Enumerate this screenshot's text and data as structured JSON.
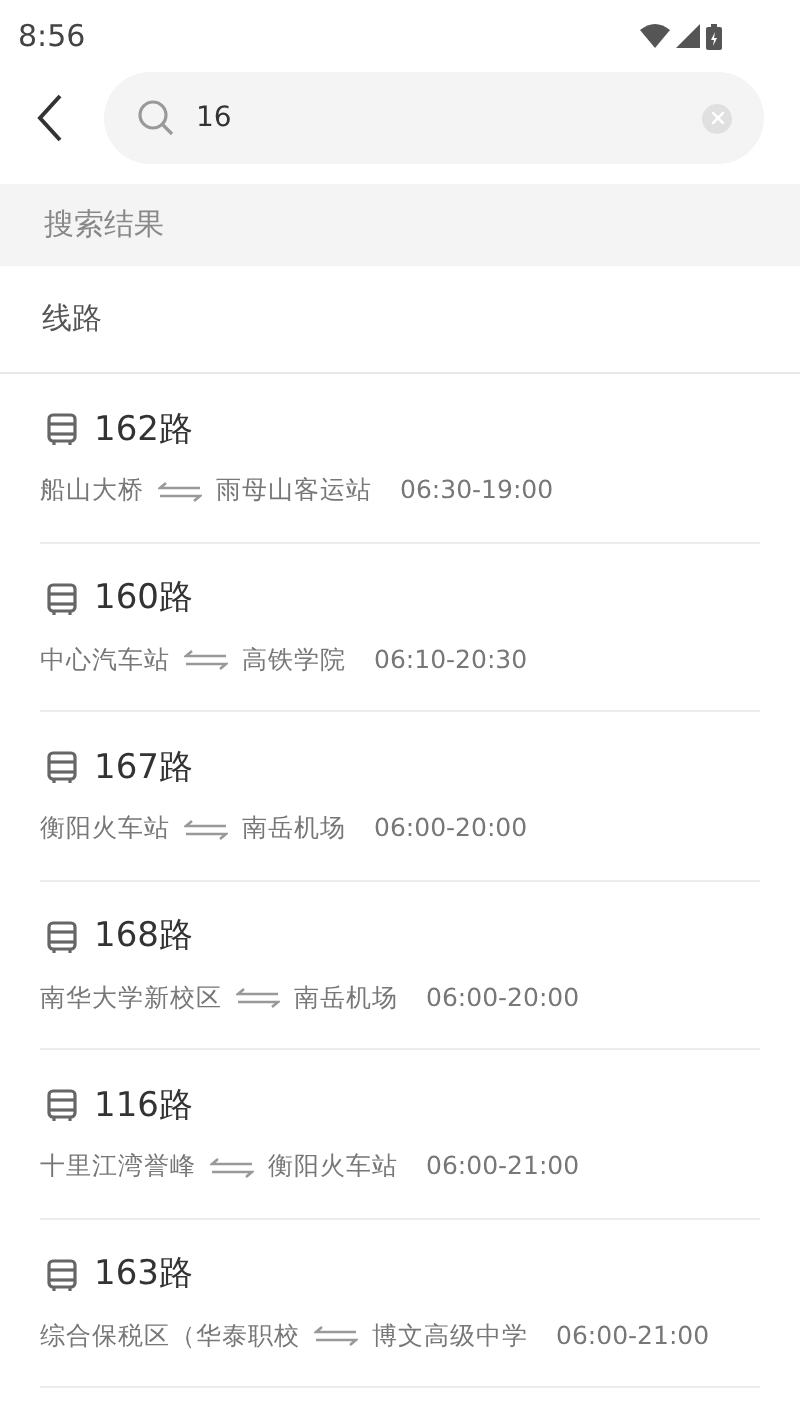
{
  "status_bar": {
    "time": "8:56"
  },
  "search": {
    "value": "16"
  },
  "section_header": "搜索结果",
  "category": "线路",
  "routes": [
    {
      "name": "162路",
      "from": "船山大桥",
      "to": "雨母山客运站",
      "hours": "06:30-19:00"
    },
    {
      "name": "160路",
      "from": "中心汽车站",
      "to": "高铁学院",
      "hours": "06:10-20:30"
    },
    {
      "name": "167路",
      "from": "衡阳火车站",
      "to": "南岳机场",
      "hours": "06:00-20:00"
    },
    {
      "name": "168路",
      "from": "南华大学新校区",
      "to": "南岳机场",
      "hours": "06:00-20:00"
    },
    {
      "name": "116路",
      "from": "十里江湾誉峰",
      "to": "衡阳火车站",
      "hours": "06:00-21:00"
    },
    {
      "name": "163路",
      "from": "综合保税区（华泰职校",
      "to": "博文高级中学",
      "hours": "06:00-21:00"
    }
  ]
}
